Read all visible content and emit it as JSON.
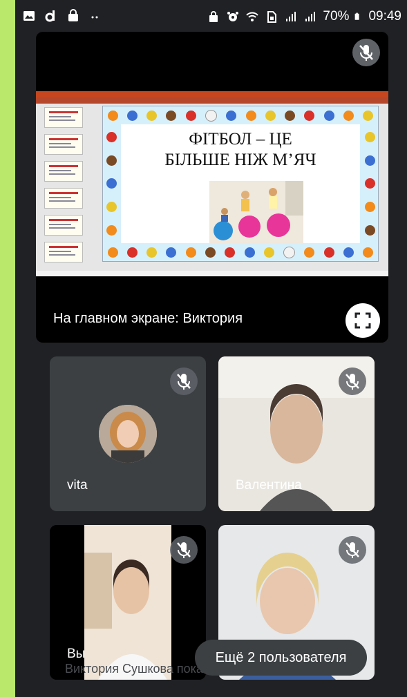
{
  "status_bar": {
    "left_icons": [
      "gallery-icon",
      "d-app-icon",
      "shopping-bag-icon",
      "more-dots-icon"
    ],
    "right_icons": [
      "lock-icon",
      "alarm-icon",
      "wifi-call-icon",
      "sim-icon",
      "signal-icon",
      "signal-icon"
    ],
    "battery": "70%",
    "time": "09:49"
  },
  "main_stage": {
    "label": "На главном экране: Виктория",
    "muted": true,
    "presentation": {
      "app": "PowerPoint",
      "title_line1": "ФІТБОЛ – ЦЕ",
      "title_line2": "БІЛЬШЕ НІЖ М’ЯЧ",
      "accent": "#c5461f"
    }
  },
  "participants": [
    {
      "name": "vita",
      "muted": true,
      "video": false
    },
    {
      "name": "Валентина",
      "muted": true,
      "video": true
    },
    {
      "name": "Вы",
      "muted": true,
      "video": true
    },
    {
      "name": "",
      "muted": true,
      "video": true
    }
  ],
  "more_users_label": "Ещё 2 пользователя",
  "sharing_notice": "Виктория Сушкова показывает свой экран.",
  "colors": {
    "background": "#202124",
    "tile": "#3c4043",
    "mic_bg": "#5f6368",
    "outer": "#c9f07a"
  }
}
